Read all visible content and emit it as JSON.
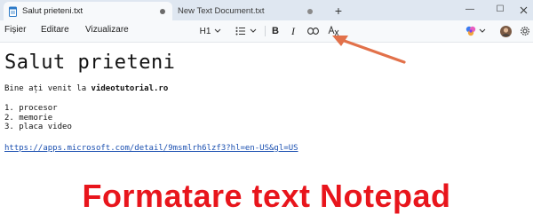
{
  "tabs": [
    {
      "label": "Salut prieteni.txt",
      "active": true
    },
    {
      "label": "New Text Document.txt",
      "active": false
    }
  ],
  "new_tab_label": "+",
  "window_controls": {
    "minimize": "—",
    "maximize": "☐"
  },
  "menu": {
    "file": "Fișier",
    "edit": "Editare",
    "view": "Vizualizare"
  },
  "toolbar": {
    "heading": "H1",
    "bold": "B",
    "italic": "I"
  },
  "document": {
    "heading": "Salut prieteni",
    "intro_text": "Bine ați venit la ",
    "intro_bold": "videotutorial.ro",
    "list_items": [
      "1. procesor",
      "2. memorie",
      "3. placa video"
    ],
    "link": "https://apps.microsoft.com/detail/9msmlrh6lzf3?hl=en-US&gl=US"
  },
  "overlay_caption": "Formatare text Notepad",
  "colors": {
    "accent": "#e8151c",
    "arrow": "#e2714a",
    "link": "#1a4fb0"
  }
}
